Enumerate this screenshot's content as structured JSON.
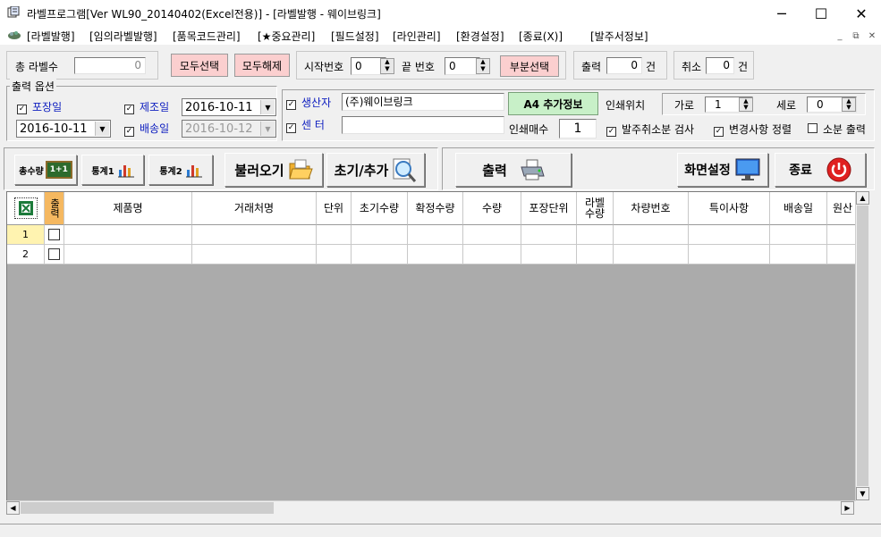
{
  "window": {
    "title": "라벨프로그램[Ver WL90_20140402(Excel전용)] - [라벨발행 - 웨이브링크]",
    "minimize": "─",
    "maximize": "☐",
    "close": "✕"
  },
  "menu": {
    "items": [
      "[라벨발행]",
      "[임의라벨발행]",
      "[품목코드관리]",
      "[★중요관리]",
      "[필드설정]",
      "[라인관리]",
      "[환경설정]",
      "[종료(X)]",
      "[발주서정보]"
    ],
    "mdi_buttons": [
      "_",
      "⧉",
      "✕"
    ]
  },
  "top": {
    "total_label": "총 라벨수",
    "total_value": "0",
    "select_all": "모두선택",
    "deselect_all": "모두해제",
    "start_no_label": "시작번호",
    "start_no_value": "0",
    "end_no_label": "끝 번호",
    "end_no_value": "0",
    "partial_select": "부분선택",
    "print_label": "출력",
    "print_value": "0",
    "print_unit": "건",
    "cancel_label": "취소",
    "cancel_value": "0",
    "cancel_unit": "건"
  },
  "options": {
    "group_label": "출력 옵션",
    "pack_date_label": "포장일",
    "mfg_date_label": "제조일",
    "mfg_date_value": "2016-10-11",
    "pack_date_value": "2016-10-11",
    "ship_date_label": "배송일",
    "ship_date_value": "2016-10-12",
    "producer_label": "생산자",
    "producer_value": "(주)웨이브링크",
    "center_label": "센 터",
    "center_value": "",
    "a4_button": "A4 추가정보",
    "print_pos_label": "인쇄위치",
    "horiz_label": "가로",
    "horiz_value": "1",
    "vert_label": "세로",
    "vert_value": "0",
    "copies_label": "인쇄매수",
    "copies_value": "1",
    "check_cancel_label": "발주취소분 검사",
    "sort_changes_label": "변경사항 정렬",
    "small_print_label": "소분 출력"
  },
  "toolbar": {
    "total_qty": "총수량",
    "total_qty_badge": "1+1",
    "stats1": "통계1",
    "stats2": "통계2",
    "load": "불러오기",
    "reset_add": "초기/추가",
    "print": "출력",
    "screen_settings": "화면설정",
    "exit": "종료"
  },
  "grid": {
    "columns": [
      "출력",
      "제품명",
      "거래처명",
      "단위",
      "초기수량",
      "확정수량",
      "수량",
      "포장단위",
      "라벨수량",
      "차량번호",
      "특이사항",
      "배송일",
      "원산"
    ],
    "rows": [
      {
        "num": "1"
      },
      {
        "num": "2"
      }
    ]
  },
  "colors": {
    "pink_button": "#fbcfcf",
    "a4_button": "#c8f0c8",
    "blue_text": "#1020c0",
    "excel_green": "#1d7b3b",
    "selected_row": "#fff3b0"
  }
}
